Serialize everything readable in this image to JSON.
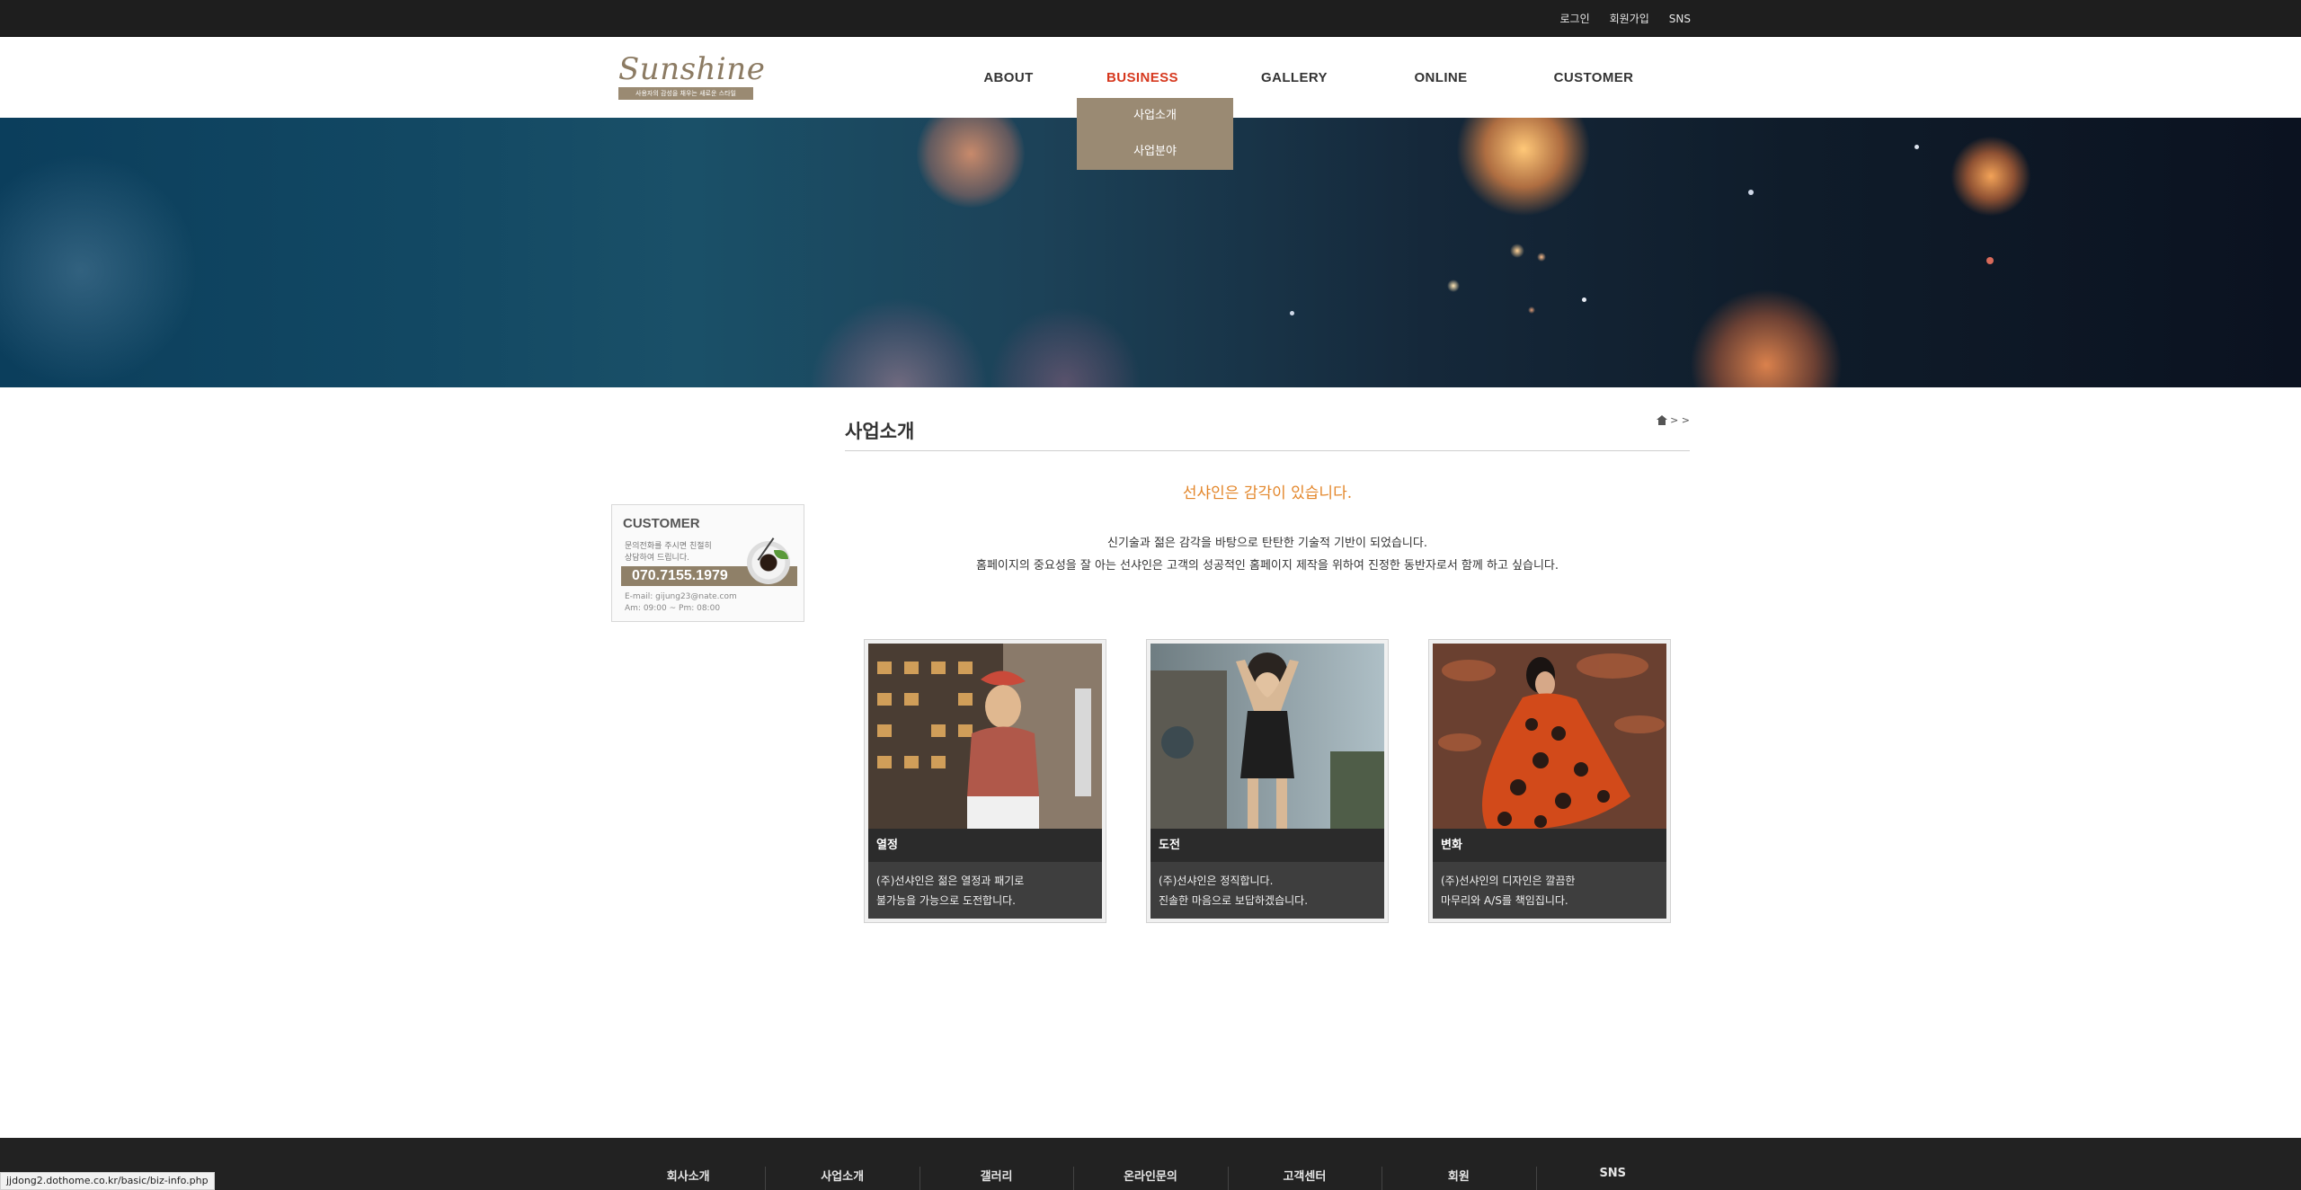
{
  "topbar": {
    "links": [
      "로그인",
      "회원가입",
      "SNS"
    ]
  },
  "logo": {
    "word": "Sunshine",
    "tagline": "사용자의 감성을 채우는 새로운 스타일"
  },
  "gnb": {
    "items": [
      "ABOUT",
      "BUSINESS",
      "GALLERY",
      "ONLINE",
      "CUSTOMER"
    ],
    "active": "BUSINESS",
    "submenu": [
      "사업소개",
      "사업분야"
    ]
  },
  "sidebar": {
    "title": "CUSTOMER",
    "desc_line1": "문의전화를 주시면 친절히",
    "desc_line2": "상담하여 드립니다.",
    "phone": "070.7155.1979",
    "email": "E-mail: gijung23@nate.com",
    "hours": "Am: 09:00 ~ Pm: 08:00"
  },
  "content": {
    "page_title": "사업소개",
    "breadcrumb": "> >",
    "lead": "선샤인은 감각이 있습니다.",
    "desc_line1": "신기술과 젊은 감각을 바탕으로 탄탄한 기술적 기반이 되었습니다.",
    "desc_line2": "홈페이지의 중요성을 잘 아는 선샤인은 고객의 성공적인 홈페이지 제작을 위하여 진정한 동반자로서 함께 하고 싶습니다.",
    "cards": [
      {
        "title": "열정",
        "line1": "(주)선샤인은 젊은 열정과 패기로",
        "line2": "불가능을 가능으로 도전합니다."
      },
      {
        "title": "도전",
        "line1": "(주)선샤인은 정직합니다.",
        "line2": "진솔한 마음으로 보답하겠습니다."
      },
      {
        "title": "변화",
        "line1": "(주)선샤인의 디자인은 깔끔한",
        "line2": "마무리와 A/S를 책임집니다."
      }
    ]
  },
  "footer": {
    "nav": [
      "회사소개",
      "사업소개",
      "갤러리",
      "온라인문의",
      "고객센터",
      "회원",
      "SNS"
    ]
  },
  "status_bar": {
    "url": "jjdong2.dothome.co.kr/basic/biz-info.php"
  },
  "colors": {
    "accent_red": "#d6381e",
    "lead_orange": "#e3862a",
    "submenu_bg": "#9a8a73",
    "topbar_bg": "#1e1e1e",
    "footer_bg": "#222222"
  }
}
